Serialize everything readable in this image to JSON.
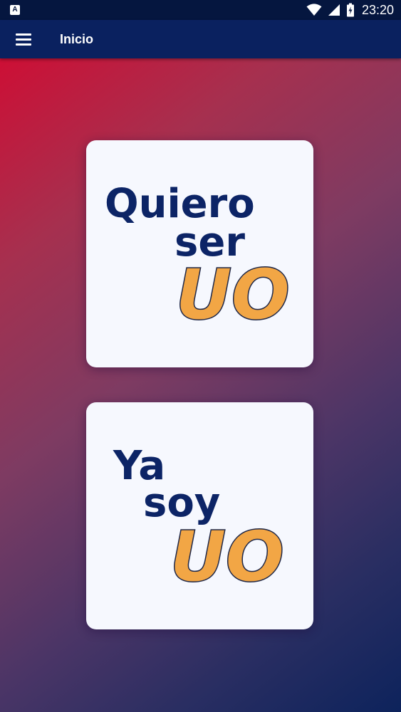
{
  "status_bar": {
    "app_icon_letter": "A",
    "time": "23:20"
  },
  "app_bar": {
    "menu_icon": "menu-icon",
    "title": "Inicio"
  },
  "cards": [
    {
      "line1": "Quiero",
      "line2": "ser",
      "brand": "UO"
    },
    {
      "line1": "Ya",
      "line2": "soy",
      "brand": "UO"
    }
  ],
  "colors": {
    "app_bar": "#0a215f",
    "status_bar": "#05163f",
    "gradient_start": "#cd0f35",
    "gradient_end": "#0d235c",
    "card_bg": "#f6f8fe",
    "word_color": "#0c2466",
    "uo_fill": "#f2a645"
  }
}
